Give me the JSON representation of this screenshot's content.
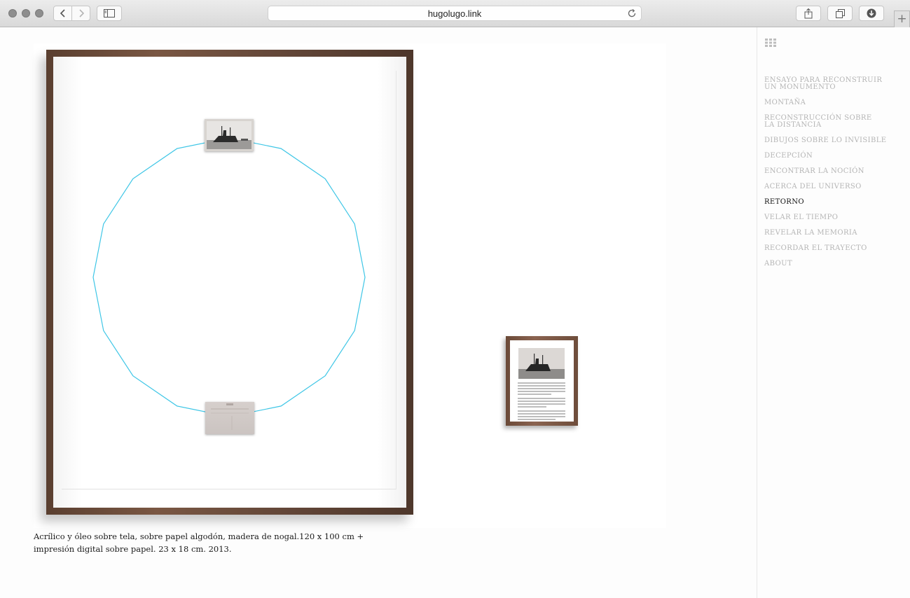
{
  "browser": {
    "url": "hugolugo.link",
    "new_tab_label": "+"
  },
  "artwork": {
    "caption_line1": "Acrílico y óleo sobre tela, sobre papel algodón, madera de nogal.120 x 100 cm +",
    "caption_line2": "impresión digital sobre papel. 23 x 18 cm. 2013."
  },
  "nav": {
    "items": [
      {
        "label": "ENSAYO PARA RECONSTRUIR",
        "label2": "UN MONUMENTO"
      },
      {
        "label": "MONTAÑA"
      },
      {
        "label": "RECONSTRUCCIÓN SOBRE",
        "label2": "LA DISTANCIA"
      },
      {
        "label": "DIBUJOS SOBRE LO INVISIBLE"
      },
      {
        "label": "DECEPCIÓN"
      },
      {
        "label": "ENCONTRAR LA NOCIÓN"
      },
      {
        "label": "ACERCA DEL UNIVERSO"
      },
      {
        "label": "RETORNO"
      },
      {
        "label": "VELAR EL TIEMPO"
      },
      {
        "label": "REVELAR LA MEMORIA"
      },
      {
        "label": "RECORDAR EL TRAYECTO"
      },
      {
        "label": "ABOUT"
      }
    ],
    "active_index": 7
  },
  "colors": {
    "polygon_line": "#3ec6e6",
    "nav_inactive": "#b4b4b4",
    "nav_active": "#111111"
  },
  "icons": {
    "back": "chevron-left-icon",
    "forward": "chevron-right-icon",
    "sidebar": "sidebar-icon",
    "reload": "reload-icon",
    "share": "share-icon",
    "tabs": "tabs-icon",
    "download": "download-icon",
    "menu": "grid-menu-icon"
  }
}
